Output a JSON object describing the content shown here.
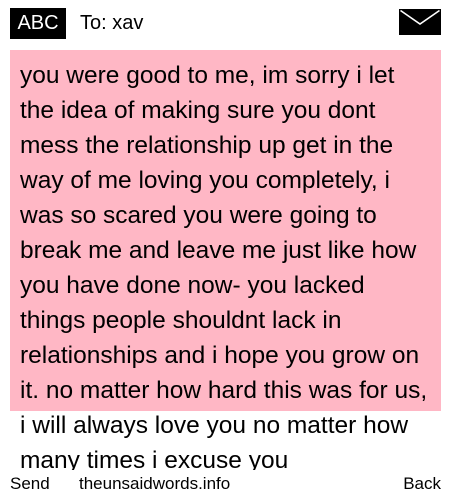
{
  "header": {
    "input_mode": "ABC",
    "recipient_label": "To: xav",
    "envelope_icon": "envelope-icon"
  },
  "message": {
    "body": "you were good to me, im sorry i let the idea of making sure you dont mess the relationship up get in the way of me loving you completely, i was so scared you were going to break me and leave me just like how you have done now- you lacked things people shouldnt lack in relationships and i hope you grow on it. no matter how hard this was for us, i will always love you no matter how many times i excuse you",
    "highlight_color": "#ffb7c5"
  },
  "softkeys": {
    "left": "Send",
    "center": "theunsaidwords.info",
    "right": "Back"
  }
}
